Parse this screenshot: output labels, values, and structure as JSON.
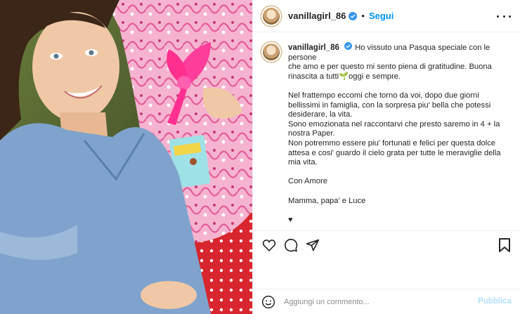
{
  "post": {
    "username": "vanillagirl_86",
    "follow_label": "Segui",
    "separator": "•",
    "caption_lines": [
      "Ho vissuto una Pasqua speciale con le persone",
      "che amo e per questo mi sento piena di gratitudine. Buona",
      "rinascita a tutti🌱oggi e sempre."
    ],
    "paragraph2": [
      "Nel frattempo eccomi che torno da voi, dopo due giorni",
      "bellissimi in famiglia, con la sorpresa piu' bella che potessi",
      "desiderare, la vita.",
      "Sono emozionata nel raccontarvi che presto saremo in 4 + la",
      "nostra Paper.",
      "Non potremmo essere piu' fortunati e felici per questa dolce",
      "attesa e cosi' guardo il cielo grata per tutte le meraviglie della",
      "mia vita."
    ],
    "sign_off": "Con Amore",
    "signature": "Mamma, papa' e Luce",
    "heart": "♥"
  },
  "comment": {
    "placeholder": "Aggiungi un commento...",
    "publish_label": "Pubblica"
  },
  "colors": {
    "accent": "#0095f6",
    "publish_disabled": "#b2dffc",
    "verified": "#3897f0",
    "dress": "#7fa3cc"
  }
}
